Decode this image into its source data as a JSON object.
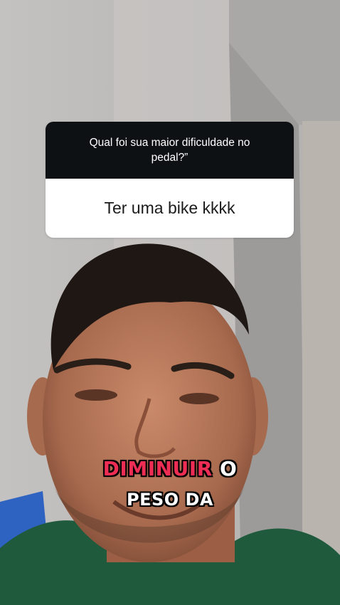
{
  "question_sticker": {
    "question": "Qual foi sua maior dificuldade no pedal?”",
    "answer": "Ter uma bike kkkk"
  },
  "captions": {
    "line1_highlight": "DIMINUIR",
    "line1_rest": "O",
    "line2": "PESO DA"
  },
  "colors": {
    "caption_highlight": "#ee2d55",
    "question_header_bg": "#0e1114",
    "answer_bg": "#ffffff"
  }
}
